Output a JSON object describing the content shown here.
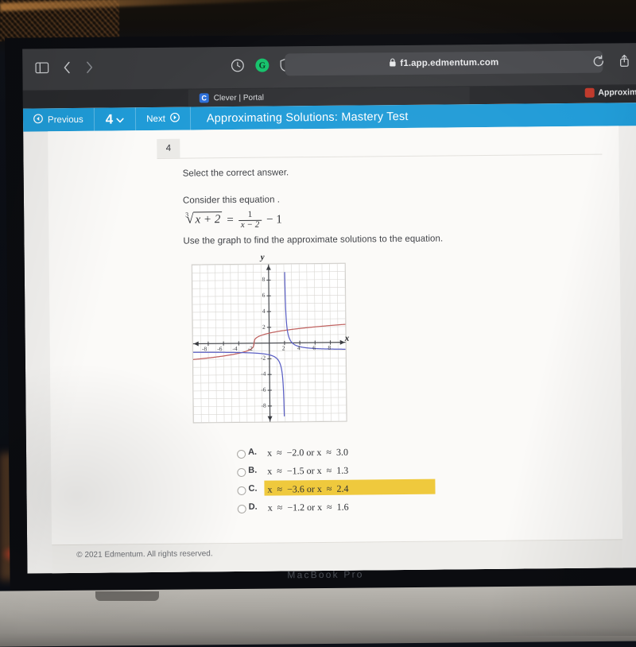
{
  "photo": {
    "device_label": "MacBook Pro"
  },
  "browser": {
    "url": "f1.app.edmentum.com",
    "lock_icon": "lock-icon",
    "sidebar_icon": "sidebar-toggle-icon",
    "back_icon": "back-chevron-icon",
    "forward_icon": "forward-chevron-icon",
    "reload_icon": "reload-icon",
    "share_icon": "share-icon",
    "extensions": [
      {
        "name": "clock-extension-icon",
        "glyph": "◴",
        "color": "#c8cacd"
      },
      {
        "name": "grammarly-extension-icon",
        "glyph": "G",
        "color": "#15c26b"
      },
      {
        "name": "privacy-shield-extension-icon",
        "glyph": "◑",
        "color": "#c8cacd"
      }
    ],
    "tabs": [
      {
        "label": "Clever | Portal",
        "favicon_letter": "C",
        "favicon_color": "#2b6ed9",
        "active": true
      },
      {
        "label": "Approximat",
        "favicon_color": "#c0392b",
        "active": false
      }
    ]
  },
  "appbar": {
    "previous_label": "Previous",
    "question_number": "4",
    "next_label": "Next",
    "title": "Approximating Solutions: Mastery Test",
    "accent_color": "#1f9bd7",
    "prev_icon": "previous-circle-icon",
    "next_icon": "next-circle-icon",
    "dropdown_icon": "chevron-down-icon"
  },
  "question": {
    "number_badge": "4",
    "instruction": "Select the correct answer.",
    "consider_text": "Consider this equation .",
    "equation": {
      "left_index": "3",
      "left_radicand": "x + 2",
      "equals": "=",
      "frac_numerator": "1",
      "frac_denominator": "x − 2",
      "tail": "− 1",
      "plain": "∛(x + 2) = 1/(x − 2) − 1"
    },
    "graph_instruction": "Use the graph to find the approximate solutions to the equation."
  },
  "chart_data": {
    "type": "line",
    "title": "",
    "xlabel": "x",
    "ylabel": "y",
    "xlim": [
      -10,
      10
    ],
    "ylim": [
      -10,
      10
    ],
    "grid": true,
    "x_ticks": [
      -8,
      -6,
      -4,
      -2,
      2,
      4,
      6,
      8
    ],
    "y_ticks": [
      -8,
      -6,
      -4,
      -2,
      2,
      4,
      6,
      8
    ],
    "x_tick_labels": [
      "-8",
      "-6",
      "-4",
      "-2",
      "2",
      "4",
      "6",
      "8"
    ],
    "y_tick_labels": [
      "-8",
      "-6",
      "-4",
      "-2",
      "2",
      "4",
      "6",
      "8"
    ],
    "legend": "none",
    "series": [
      {
        "name": "y = cbrt(x + 2)",
        "color": "#c0615f",
        "x_root": -2,
        "description": "cube root curve, increasing, crosses x-axis at x = -2"
      },
      {
        "name": "y = 1/(x - 2) - 1",
        "color": "#5a5fc4",
        "vertical_asymptote": 2,
        "horizontal_asymptote": -1,
        "description": "rational hyperbola with vertical asymptote x = 2 and horizontal asymptote y = -1"
      }
    ],
    "intersections": [
      {
        "x": -3.6,
        "y": -1.2
      },
      {
        "x": 2.4,
        "y": 1.5
      }
    ]
  },
  "choices": [
    {
      "letter": "A.",
      "text": "x  ≈  −2.0 or x  ≈  3.0",
      "selected": false,
      "highlighted": false
    },
    {
      "letter": "B.",
      "text": "x  ≈  −1.5 or x  ≈  1.3",
      "selected": false,
      "highlighted": false
    },
    {
      "letter": "C.",
      "text": "x  ≈  −3.6 or x  ≈  2.4",
      "selected": false,
      "highlighted": true
    },
    {
      "letter": "D.",
      "text": "x  ≈  −1.2 or x  ≈  1.6",
      "selected": false,
      "highlighted": false
    }
  ],
  "highlight_color": "#efc93d",
  "footer": {
    "copyright": "© 2021 Edmentum. All rights reserved."
  },
  "cursor": {
    "icon": "pointing-hand-cursor"
  }
}
